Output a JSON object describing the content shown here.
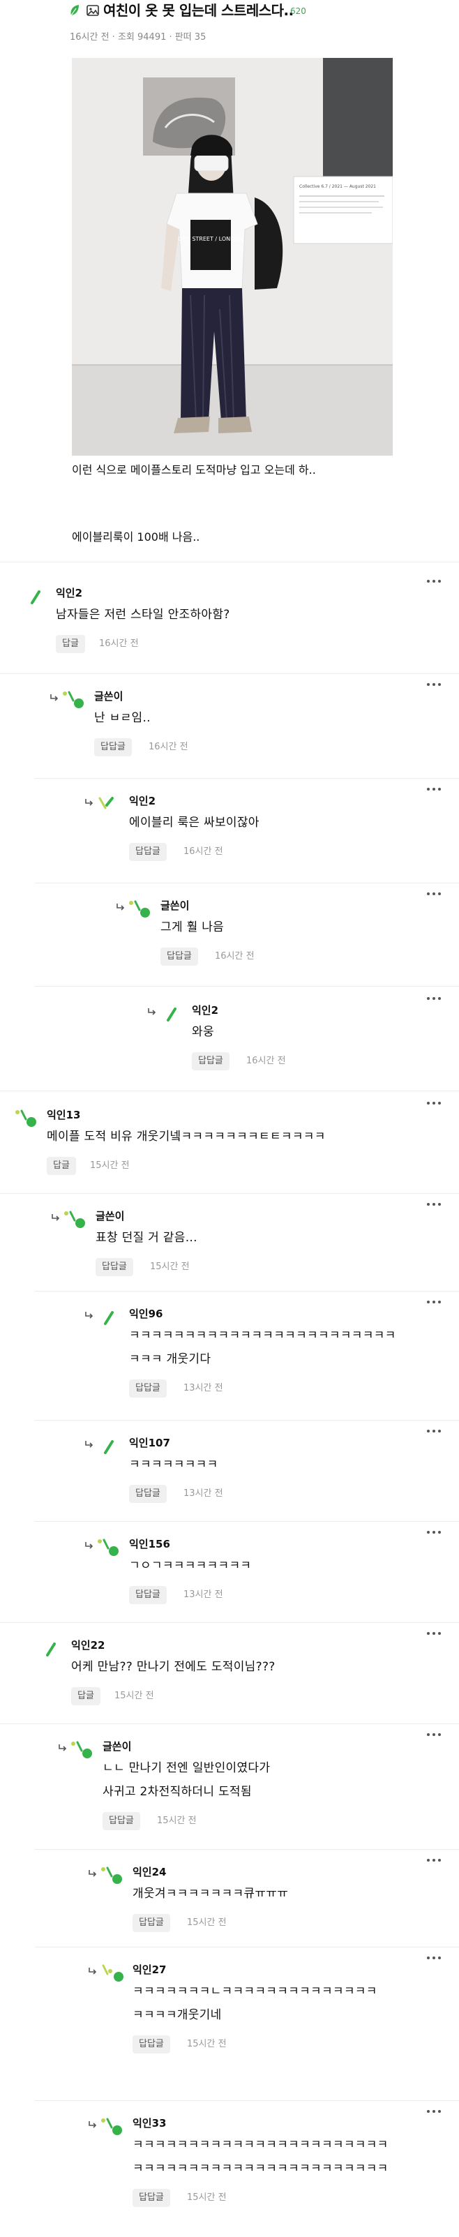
{
  "post": {
    "title": "여친이 옷 못 입는데 스트레스다..",
    "comment_count": "620",
    "meta": "16시간 전 · 조회 94491 · 판떠 35",
    "body_lines": [
      "이런 식으로 메이플스토리 도적마냥 입고 오는데 하..",
      "에이블리룩이 100배 나음.."
    ],
    "icons": [
      "leaf-icon",
      "image-icon"
    ]
  },
  "photo": {
    "poster_text": [
      "Collective 6.7 / 2021 — August 2021"
    ],
    "shirt_text": "DOT STREET / LONDON"
  },
  "comments": [
    {
      "author": "익인2",
      "text": [
        "남자들은 저런 스타일 안조하아함?"
      ],
      "reply": "답글",
      "time": "16시간 전"
    },
    {
      "author": "글쓴이",
      "text": [
        "난 ㅂㄹ임.."
      ],
      "reply": "답답글",
      "time": "16시간 전"
    },
    {
      "author": "익인2",
      "text": [
        "에이블리 룩은 싸보이잖아"
      ],
      "reply": "답답글",
      "time": "16시간 전"
    },
    {
      "author": "글쓴이",
      "text": [
        "그게 훨 나음"
      ],
      "reply": "답답글",
      "time": "16시간 전"
    },
    {
      "author": "익인2",
      "text": [
        "와웅"
      ],
      "reply": "답답글",
      "time": "16시간 전"
    },
    {
      "author": "익인13",
      "text": [
        "메이플 도적 비유 개웃기넼ㅋㅋㅋㅋㅋㅋㅋㅌㅌㅋㅋㅋㅋ"
      ],
      "reply": "답글",
      "time": "15시간 전"
    },
    {
      "author": "글쓴이",
      "text": [
        "표창 던질 거 같음..."
      ],
      "reply": "답답글",
      "time": "15시간 전"
    },
    {
      "author": "익인96",
      "text": [
        "ㅋㅋㅋㅋㅋㅋㅋㅋㅋㅋㅋㅋㅋㅋㅋㅋㅋㅋㅋㅋㅋㅋㅋㅋ",
        "ㅋㅋㅋ 개웃기다"
      ],
      "reply": "답답글",
      "time": "13시간 전"
    },
    {
      "author": "익인107",
      "text": [
        "ㅋㅋㅋㅋㅋㅋㅋㅋ"
      ],
      "reply": "답답글",
      "time": "13시간 전"
    },
    {
      "author": "익인156",
      "text": [
        "ㄱㅇㄱㅋㅋㅋㅋㅋㅋㅋㅋ"
      ],
      "reply": "답답글",
      "time": "13시간 전"
    },
    {
      "author": "익인22",
      "text": [
        "어케 만남?? 만나기 전에도 도적이님???"
      ],
      "reply": "답글",
      "time": "15시간 전"
    },
    {
      "author": "글쓴이",
      "text": [
        "ㄴㄴ 만나기 전엔 일반인이였다가",
        "사귀고 2차전직하더니 도적됨"
      ],
      "reply": "답답글",
      "time": "15시간 전"
    },
    {
      "author": "익인24",
      "text": [
        "개웃겨ㅋㅋㅋㅋㅋㅋㅋ큐ㅠㅠㅠ"
      ],
      "reply": "답답글",
      "time": "15시간 전"
    },
    {
      "author": "익인27",
      "text": [
        "ㅋㅋㅋㅋㅋㅋㅋㄴㅋㅋㅋㅋㅋㅋㅋㅋㅋㅋㅋㅋㅋㅋ",
        "ㅋㅋㅋㅋ개웃기네"
      ],
      "reply": "답답글",
      "time": "15시간 전"
    },
    {
      "author": "익인33",
      "text": [
        "ㅋㅋㅋㅋㅋㅋㅋㅋㅋㅋㅋㅋㅋㅋㅋㅋㅋㅋㅋㅋㅋㅋㅋ",
        "ㅋㅋㅋㅋㅋㅋㅋㅋㅋㅋㅋㅋㅋㅋㅋㅋㅋㅋㅋㅋㅋㅋㅋ"
      ],
      "reply": "답답글",
      "time": "15시간 전"
    }
  ],
  "colors": {
    "accent": "#3aa655",
    "leaf": "#36b24a",
    "lime": "#b9d651",
    "text": "#111111",
    "muted": "#999999",
    "chip_bg": "#f0f0f0"
  }
}
